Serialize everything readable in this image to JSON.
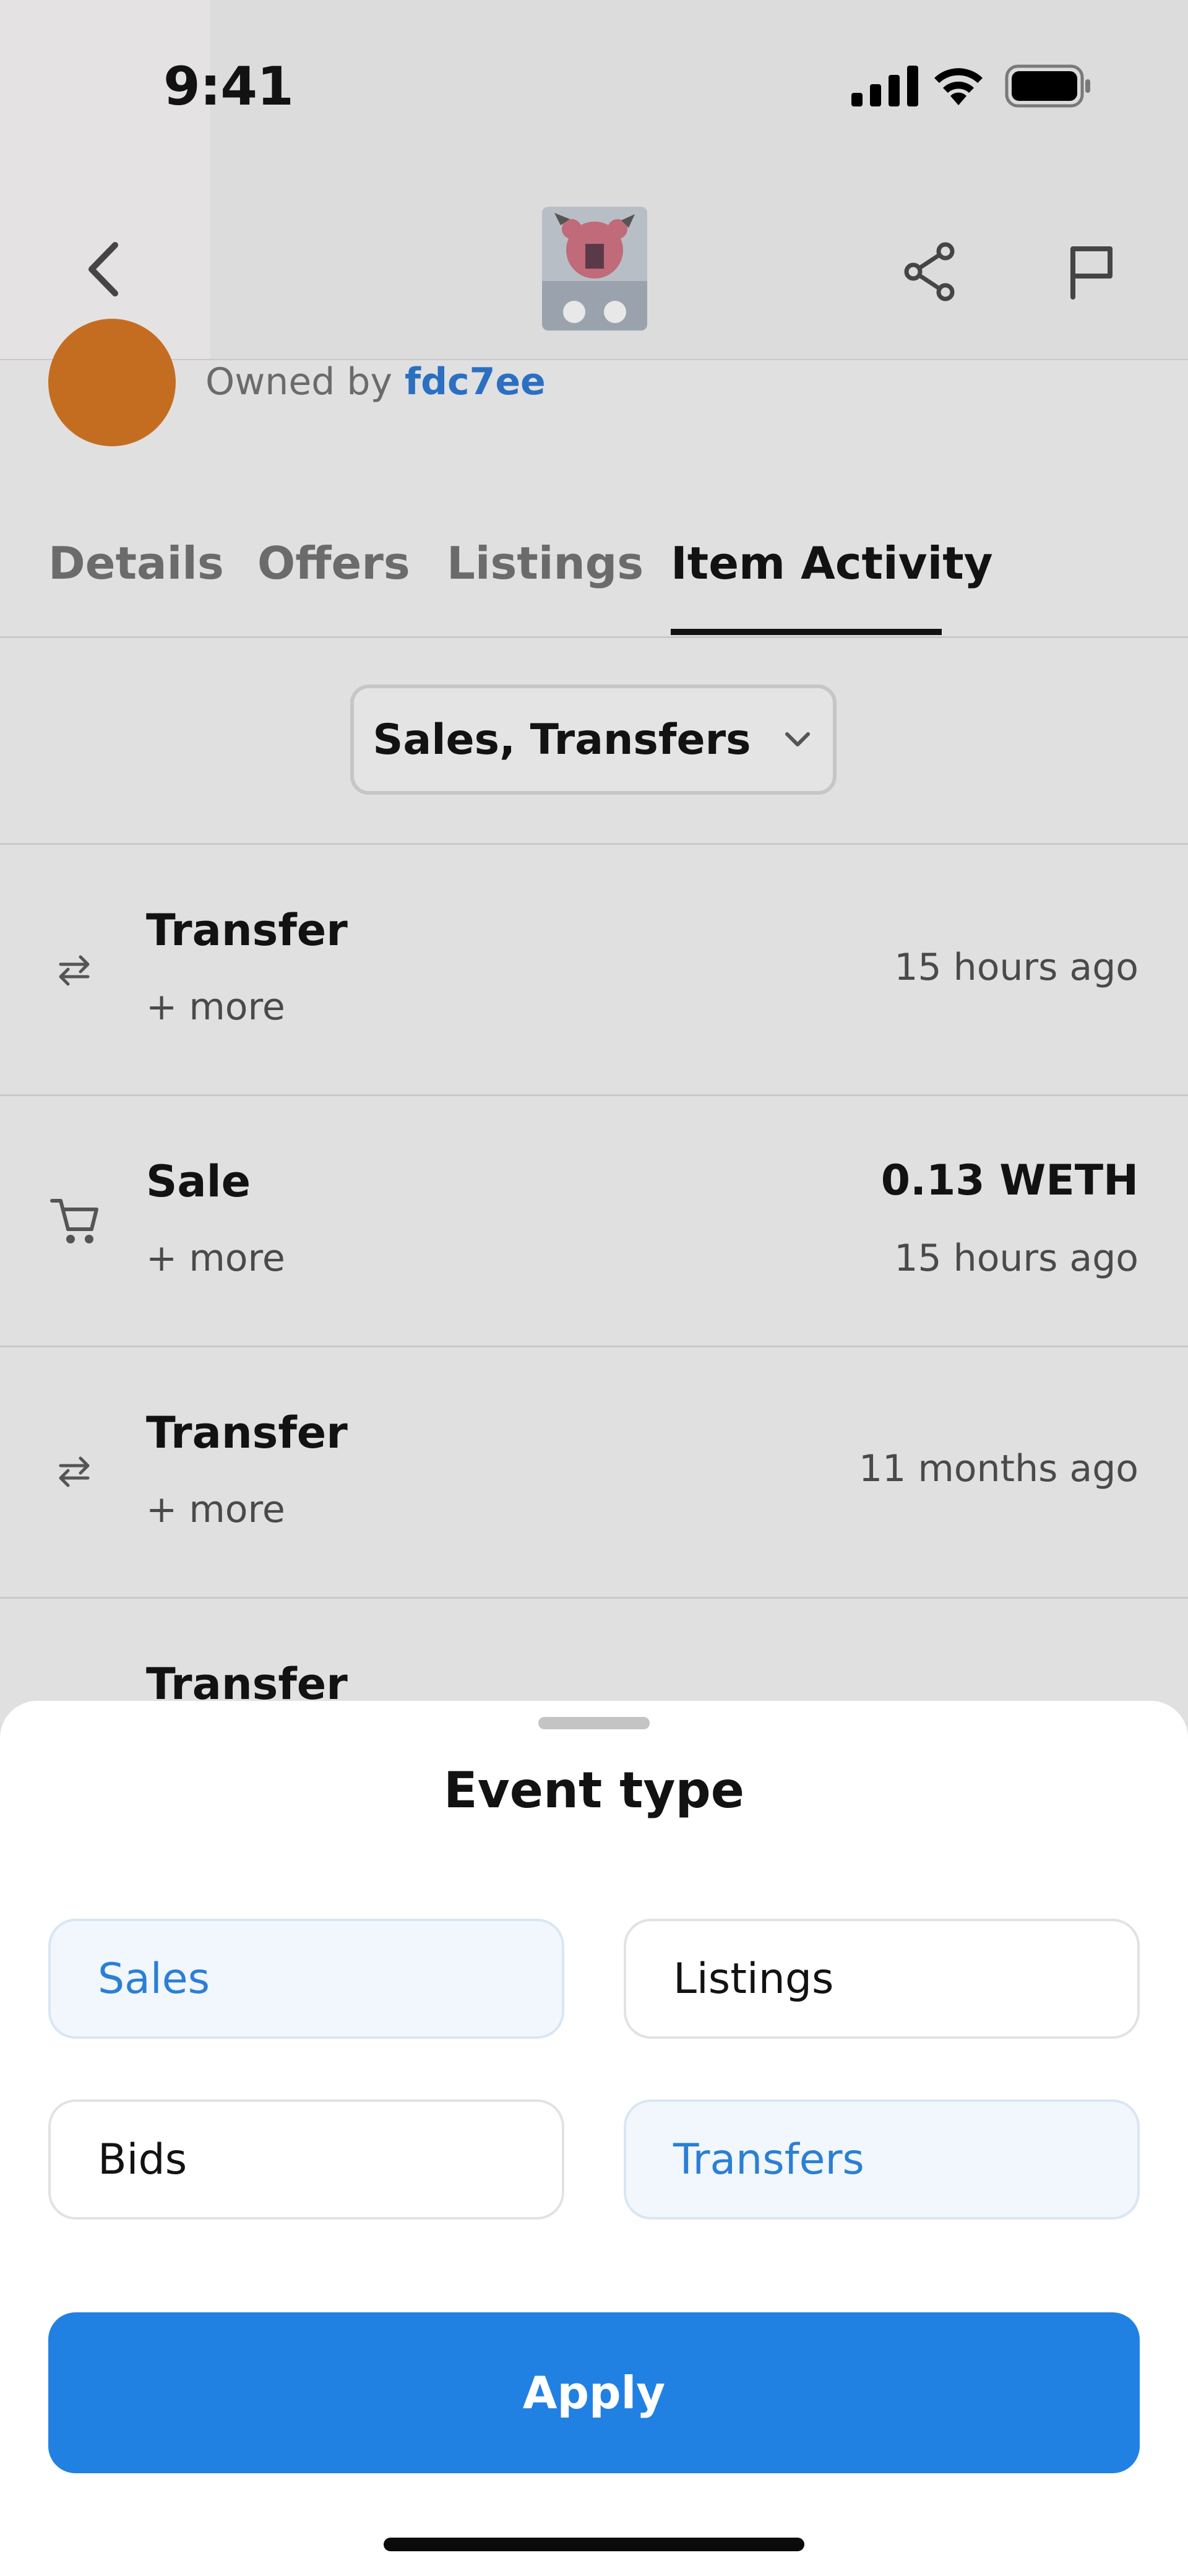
{
  "status_bar": {
    "time": "9:41"
  },
  "owner": {
    "prefix": "Owned by",
    "name": "fdc7ee"
  },
  "tabs": [
    {
      "label": "Details",
      "active": false
    },
    {
      "label": "Offers",
      "active": false
    },
    {
      "label": "Listings",
      "active": false
    },
    {
      "label": "Item Activity",
      "active": true
    }
  ],
  "filter": {
    "label": "Sales, Transfers"
  },
  "activity": [
    {
      "type": "Transfer",
      "more": "+ more",
      "time": "15 hours ago",
      "icon": "transfer-icon"
    },
    {
      "type": "Sale",
      "more": "+ more",
      "price": "0.13 WETH",
      "time": "15 hours ago",
      "icon": "cart-icon"
    },
    {
      "type": "Transfer",
      "more": "+ more",
      "time": "11 months ago",
      "icon": "transfer-icon"
    },
    {
      "type": "Transfer",
      "icon": "transfer-icon"
    }
  ],
  "sheet": {
    "title": "Event type",
    "options": [
      {
        "label": "Sales",
        "selected": true
      },
      {
        "label": "Listings",
        "selected": false
      },
      {
        "label": "Bids",
        "selected": false
      },
      {
        "label": "Transfers",
        "selected": true
      }
    ],
    "apply_label": "Apply"
  },
  "colors": {
    "accent": "#2181e2",
    "avatar": "#c46d20",
    "owner_link": "#2b6fc2"
  }
}
